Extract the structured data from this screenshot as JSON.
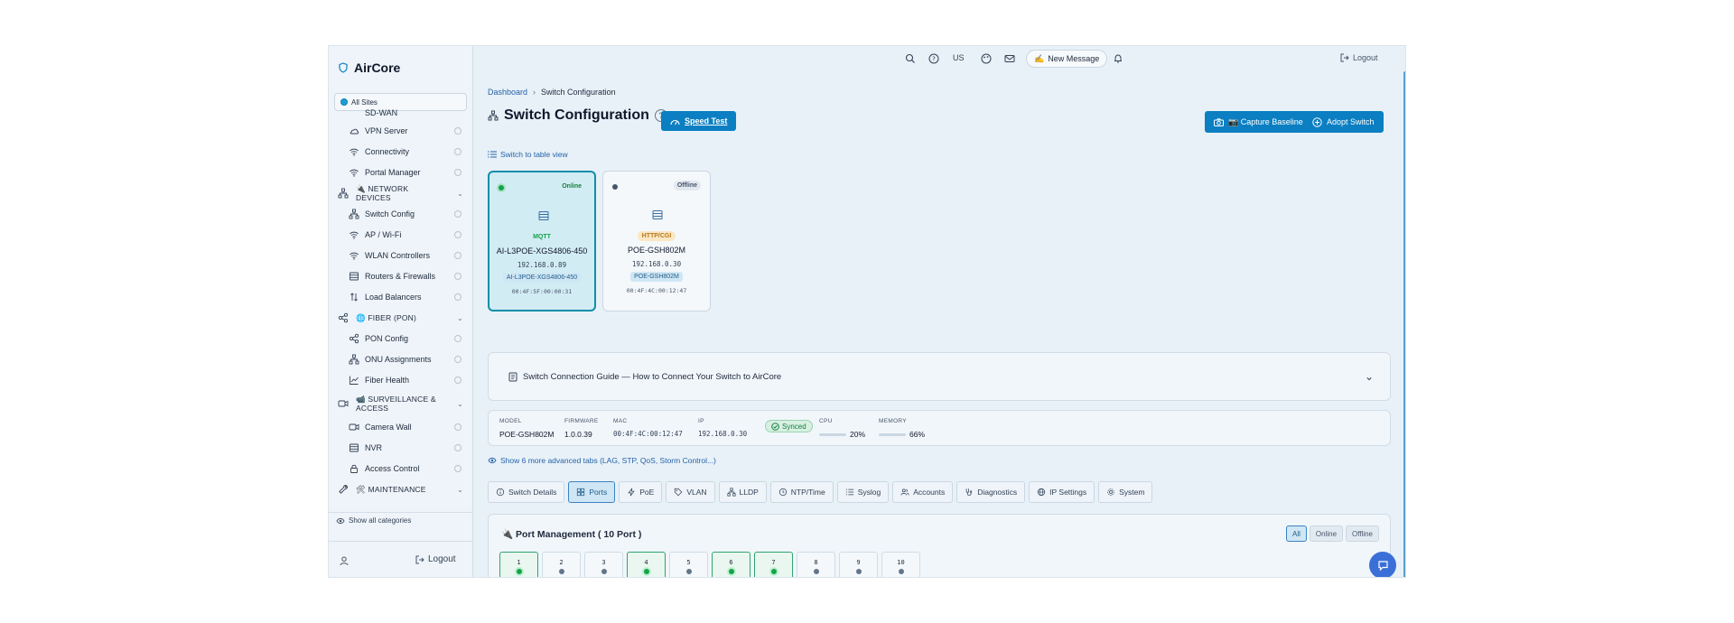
{
  "brand": {
    "name": "AirCore"
  },
  "site_selector": {
    "label": "All Sites"
  },
  "sidebar": {
    "clipped_item": "SD-WAN",
    "items": [
      {
        "label": "VPN Server",
        "kind": "item",
        "icon": "cloud-icon"
      },
      {
        "label": "Connectivity",
        "kind": "item",
        "icon": "wifi-icon"
      },
      {
        "label": "Portal Manager",
        "kind": "item",
        "icon": "wifi-icon"
      },
      {
        "label": "NETWORK DEVICES",
        "kind": "section",
        "icon": "network-icon",
        "emoji": "🔌"
      },
      {
        "label": "Switch Config",
        "kind": "item",
        "icon": "network-icon"
      },
      {
        "label": "AP / Wi-Fi",
        "kind": "item",
        "icon": "wifi-icon"
      },
      {
        "label": "WLAN Controllers",
        "kind": "item",
        "icon": "wifi-icon"
      },
      {
        "label": "Routers & Firewalls",
        "kind": "item",
        "icon": "server-icon"
      },
      {
        "label": "Load Balancers",
        "kind": "item",
        "icon": "arrows-updown-icon"
      },
      {
        "label": "FIBER (PON)",
        "kind": "section",
        "icon": "share-icon",
        "emoji": "🌐"
      },
      {
        "label": "PON Config",
        "kind": "item",
        "icon": "share-icon"
      },
      {
        "label": "ONU Assignments",
        "kind": "item",
        "icon": "network-icon"
      },
      {
        "label": "Fiber Health",
        "kind": "item",
        "icon": "chart-line-icon"
      },
      {
        "label": "SURVEILLANCE & ACCESS",
        "kind": "section",
        "icon": "video-icon",
        "emoji": "📹"
      },
      {
        "label": "Camera Wall",
        "kind": "item",
        "icon": "video-icon"
      },
      {
        "label": "NVR",
        "kind": "item",
        "icon": "server-icon"
      },
      {
        "label": "Access Control",
        "kind": "item",
        "icon": "lock-icon"
      },
      {
        "label": "MAINTENANCE",
        "kind": "section",
        "icon": "wrench-icon",
        "emoji": "🛠"
      }
    ],
    "show_all": "Show all categories",
    "logout": "Logout"
  },
  "topbar": {
    "lang": "US",
    "new_message": "New Message",
    "logout": "Logout"
  },
  "breadcrumb": {
    "home": "Dashboard",
    "current": "Switch Configuration"
  },
  "page": {
    "title": "Switch Configuration",
    "speed_test": "Speed Test",
    "capture_baseline": "📷 Capture Baseline",
    "adopt_switch": "Adopt Switch",
    "table_view": "Switch to table view"
  },
  "switches": [
    {
      "status": "Online",
      "protocol": "MQTT",
      "name": "AI-L3POE-XGS4806-450",
      "ip": "192.168.0.89",
      "model": "AI-L3POE-XGS4806-450",
      "mac": "00:4F:5F:00:00:31",
      "active": true
    },
    {
      "status": "Offline",
      "protocol": "HTTP/CGI",
      "name": "POE-GSH802M",
      "ip": "192.168.0.30",
      "model": "POE-GSH802M",
      "mac": "00:4F:4C:00:12:47",
      "active": false
    }
  ],
  "guide": {
    "title": "Switch Connection Guide — How to Connect Your Switch to AirCore"
  },
  "info": {
    "model_label": "MODEL",
    "model": "POE-GSH802M",
    "firmware_label": "FIRMWARE",
    "firmware": "1.0.0.39",
    "mac_label": "MAC",
    "mac": "00:4F:4C:00:12:47",
    "ip_label": "IP",
    "ip": "192.168.0.30",
    "synced": "Synced",
    "cpu_label": "CPU",
    "cpu": "20%",
    "memory_label": "MEMORY",
    "memory": "66%"
  },
  "advanced_link": "Show 6 more advanced tabs (LAG, STP, QoS, Storm Control...)",
  "tabs": [
    {
      "label": "Switch Details",
      "icon": "info-icon"
    },
    {
      "label": "Ports",
      "icon": "grid-icon",
      "active": true
    },
    {
      "label": "PoE",
      "icon": "bolt-icon"
    },
    {
      "label": "VLAN",
      "icon": "tag-icon"
    },
    {
      "label": "LLDP",
      "icon": "network-icon"
    },
    {
      "label": "NTP/Time",
      "icon": "clock-icon"
    },
    {
      "label": "Syslog",
      "icon": "list-icon"
    },
    {
      "label": "Accounts",
      "icon": "users-icon"
    },
    {
      "label": "Diagnostics",
      "icon": "stethoscope-icon"
    },
    {
      "label": "IP Settings",
      "icon": "globe-icon"
    },
    {
      "label": "System",
      "icon": "gear-icon"
    }
  ],
  "ports_panel": {
    "title": "🔌 Port Management ( 10 Port )",
    "filters": [
      "All",
      "Online",
      "Offline"
    ],
    "ports": [
      {
        "num": "1",
        "state": "UP"
      },
      {
        "num": "2",
        "state": "DOWN"
      },
      {
        "num": "3",
        "state": "DOWN"
      },
      {
        "num": "4",
        "state": "UP"
      },
      {
        "num": "5",
        "state": "DOWN"
      },
      {
        "num": "6",
        "state": "UP"
      },
      {
        "num": "7",
        "state": "UP"
      },
      {
        "num": "8",
        "state": "DOWN"
      },
      {
        "num": "9",
        "state": "DOWN"
      },
      {
        "num": "10",
        "state": "DOWN"
      }
    ]
  },
  "colors": {
    "accent": "#0b7fc2",
    "online": "#16a34a",
    "offline": "#64748b"
  }
}
